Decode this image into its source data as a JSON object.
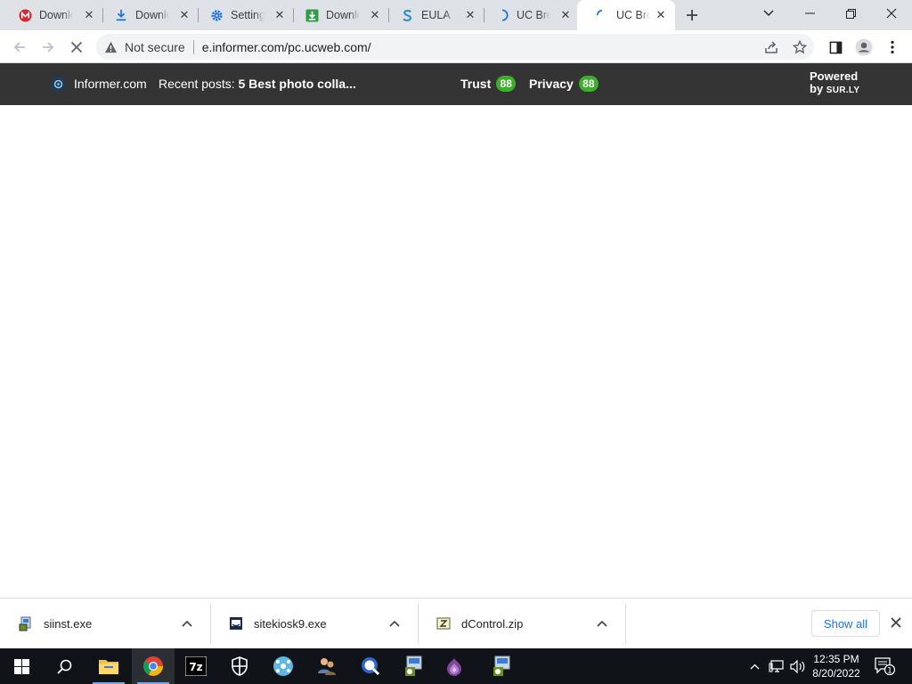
{
  "tabs": [
    {
      "title": "Download",
      "icon": "mega-icon",
      "active": false
    },
    {
      "title": "Download",
      "icon": "download-icon",
      "active": false
    },
    {
      "title": "Settings",
      "icon": "settings-gear-icon",
      "active": false
    },
    {
      "title": "Download",
      "icon": "green-download-icon",
      "active": false
    },
    {
      "title": "EULA",
      "icon": "s-logo-icon",
      "active": false
    },
    {
      "title": "UC Brow",
      "icon": "loading-spinner-icon",
      "active": false
    },
    {
      "title": "UC Brow",
      "icon": "loading-spinner-icon",
      "active": true
    }
  ],
  "omnibox": {
    "security_label": "Not secure",
    "url": "e.informer.com/pc.ucweb.com/"
  },
  "informer_bar": {
    "site": "Informer.com",
    "recent_label": "Recent posts:",
    "recent_post": "5 Best photo colla...",
    "trust_label": "Trust",
    "trust_score": "88",
    "privacy_label": "Privacy",
    "privacy_score": "88",
    "powered_line1": "Powered",
    "powered_by": "by",
    "powered_brand": "SUR.LY",
    "score_color": "#3dae2b"
  },
  "downloads": [
    {
      "name": "siinst.exe",
      "icon": "installer-icon"
    },
    {
      "name": "sitekiosk9.exe",
      "icon": "sitekiosk-icon"
    },
    {
      "name": "dControl.zip",
      "icon": "zip-archive-icon"
    }
  ],
  "download_shelf": {
    "show_all_label": "Show all"
  },
  "taskbar": {
    "apps": [
      "start",
      "search",
      "file-explorer",
      "chrome",
      "7zip",
      "security-shield",
      "network-app",
      "users-app",
      "search-tool",
      "installer",
      "tor-browser",
      "installer-2"
    ],
    "time": "12:35 PM",
    "date": "8/20/2022",
    "notification_count": "1"
  },
  "colors": {
    "tabstrip": "#dee1e6",
    "infobar": "#343434",
    "accent_blue": "#1a73e8",
    "taskbar": "#101418"
  }
}
